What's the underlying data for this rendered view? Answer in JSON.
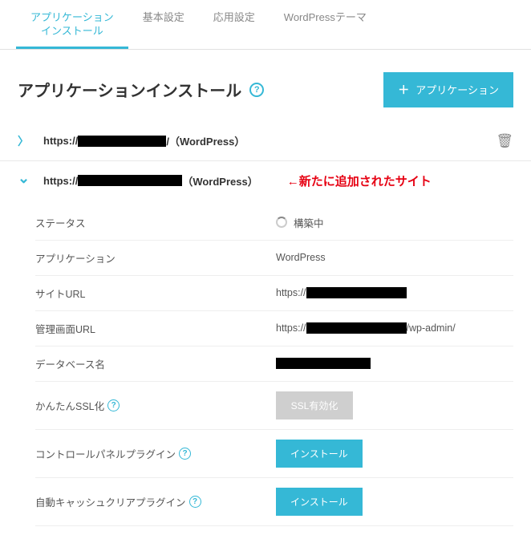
{
  "tabs": {
    "app_install": "アプリケーション\nインストール",
    "basic": "基本設定",
    "advanced": "応用設定",
    "wp_theme": "WordPressテーマ"
  },
  "header": {
    "title": "アプリケーションインストール",
    "add_button": "アプリケーション"
  },
  "sites": [
    {
      "prefix": "https://",
      "suffix": "/（WordPress）",
      "expanded": false
    },
    {
      "prefix": "https://",
      "suffix": "（WordPress）",
      "annotation": "←新たに追加されたサイト",
      "expanded": true
    }
  ],
  "details": {
    "status_label": "ステータス",
    "status_value": "構築中",
    "app_label": "アプリケーション",
    "app_value": "WordPress",
    "siteurl_label": "サイトURL",
    "siteurl_prefix": "https://",
    "adminurl_label": "管理画面URL",
    "adminurl_prefix": "https://",
    "adminurl_suffix": "/wp-admin/",
    "db_label": "データベース名",
    "ssl_label": "かんたんSSL化",
    "ssl_button": "SSL有効化",
    "cp_plugin_label": "コントロールパネルプラグイン",
    "cp_plugin_button": "インストール",
    "cache_plugin_label": "自動キャッシュクリアプラグイン",
    "cache_plugin_button": "インストール"
  },
  "icons": {
    "help": "?",
    "plus": "＋",
    "trash": "🗑"
  }
}
